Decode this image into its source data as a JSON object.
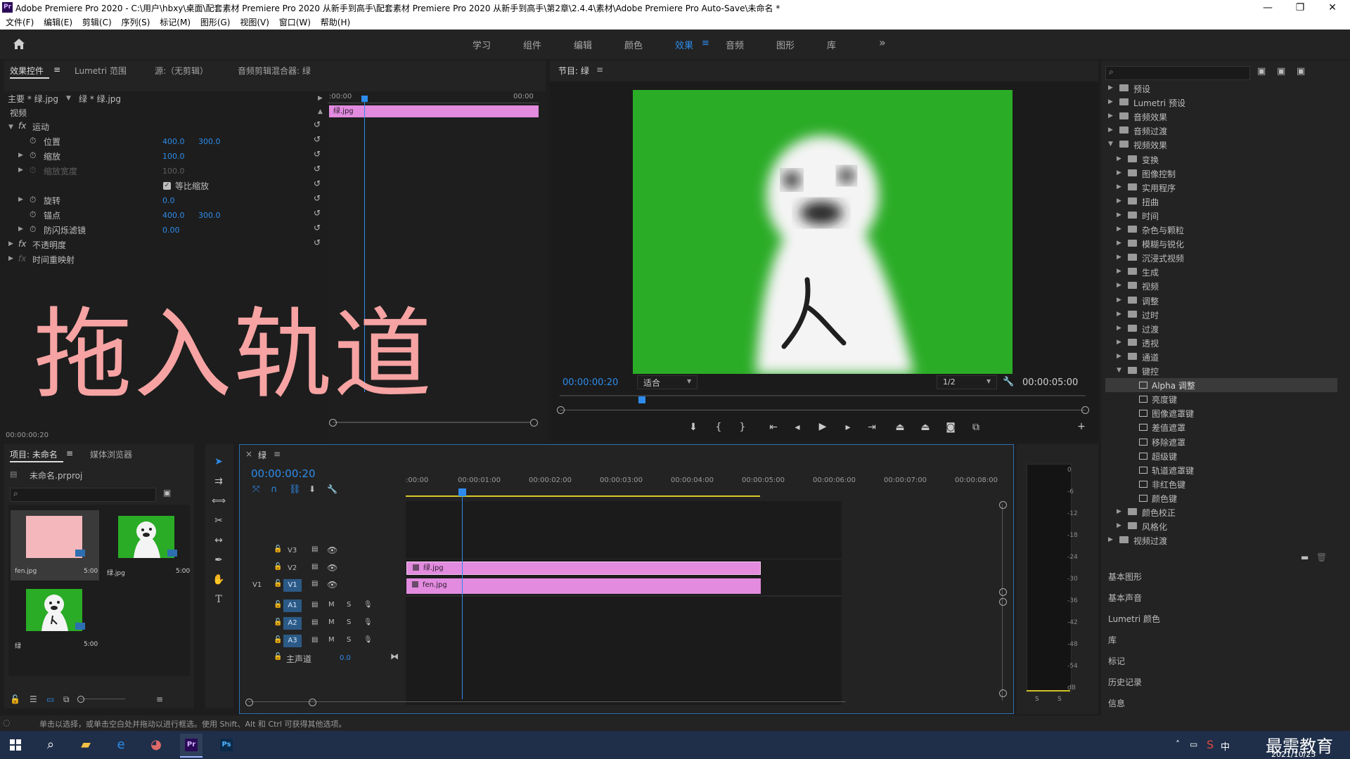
{
  "window": {
    "title": "Adobe Premiere Pro 2020 - C:\\用户\\hbxy\\桌面\\配套素材 Premiere Pro 2020 从新手到高手\\配套素材 Premiere Pro 2020 从新手到高手\\第2章\\2.4.4\\素材\\Adobe Premiere Pro Auto-Save\\未命名 *",
    "logo": "Pr",
    "minimize": "—",
    "maximize": "❐",
    "close": "✕"
  },
  "menubar": [
    "文件(F)",
    "编辑(E)",
    "剪辑(C)",
    "序列(S)",
    "标记(M)",
    "图形(G)",
    "视图(V)",
    "窗口(W)",
    "帮助(H)"
  ],
  "workspaces": {
    "items": [
      "学习",
      "组件",
      "编辑",
      "颜色",
      "效果",
      "音频",
      "图形",
      "库"
    ],
    "active": "效果",
    "more": "»",
    "menu": "≡"
  },
  "effect_controls": {
    "tabs": [
      "效果控件",
      "Lumetri 范围",
      "源:（无剪辑）",
      "音频剪辑混合器: 绿"
    ],
    "tab_menu": "≡",
    "master": "主要 * 绿.jpg",
    "sequence_clip": "绿 * 绿.jpg",
    "section": "视频",
    "fx": "fx",
    "motion": "运动",
    "position_label": "位置",
    "position_x": "400.0",
    "position_y": "300.0",
    "scale_label": "缩放",
    "scale_value": "100.0",
    "scale_width_label": "缩放宽度",
    "scale_width_value": "100.0",
    "uniform_label": "等比缩放",
    "rotation_label": "旋转",
    "rotation_value": "0.0",
    "anchor_label": "锚点",
    "anchor_x": "400.0",
    "anchor_y": "300.0",
    "flicker_label": "防闪烁滤镜",
    "flicker_value": "0.00",
    "opacity_label": "不透明度",
    "remap_label": "时间重映射",
    "time_start": ":00:00",
    "time_end": "00:00",
    "clip_name": "绿.jpg",
    "timecode": "00:00:00:20",
    "overlay_text": "拖入轨道"
  },
  "program_monitor": {
    "title": "节目: 绿",
    "menu": "≡",
    "timecode": "00:00:00:20",
    "fit": "适合",
    "resolution": "1/2",
    "duration": "00:00:05:00"
  },
  "effects_panel": {
    "search_placeholder": "",
    "tree": [
      {
        "label": "预设",
        "level": 0,
        "expanded": false
      },
      {
        "label": "Lumetri 预设",
        "level": 0,
        "expanded": false
      },
      {
        "label": "音频效果",
        "level": 0,
        "expanded": false
      },
      {
        "label": "音频过渡",
        "level": 0,
        "expanded": false
      },
      {
        "label": "视频效果",
        "level": 0,
        "expanded": true
      },
      {
        "label": "变换",
        "level": 1,
        "expanded": false
      },
      {
        "label": "图像控制",
        "level": 1,
        "expanded": false
      },
      {
        "label": "实用程序",
        "level": 1,
        "expanded": false
      },
      {
        "label": "扭曲",
        "level": 1,
        "expanded": false
      },
      {
        "label": "时间",
        "level": 1,
        "expanded": false
      },
      {
        "label": "杂色与颗粒",
        "level": 1,
        "expanded": false
      },
      {
        "label": "模糊与锐化",
        "level": 1,
        "expanded": false
      },
      {
        "label": "沉浸式视频",
        "level": 1,
        "expanded": false
      },
      {
        "label": "生成",
        "level": 1,
        "expanded": false
      },
      {
        "label": "视频",
        "level": 1,
        "expanded": false
      },
      {
        "label": "调整",
        "level": 1,
        "expanded": false
      },
      {
        "label": "过时",
        "level": 1,
        "expanded": false
      },
      {
        "label": "过渡",
        "level": 1,
        "expanded": false
      },
      {
        "label": "透视",
        "level": 1,
        "expanded": false
      },
      {
        "label": "通道",
        "level": 1,
        "expanded": false
      },
      {
        "label": "键控",
        "level": 1,
        "expanded": true
      },
      {
        "label": "Alpha 调整",
        "level": 2,
        "selected": true
      },
      {
        "label": "亮度键",
        "level": 2
      },
      {
        "label": "图像遮罩键",
        "level": 2
      },
      {
        "label": "差值遮罩",
        "level": 2
      },
      {
        "label": "移除遮罩",
        "level": 2
      },
      {
        "label": "超级键",
        "level": 2
      },
      {
        "label": "轨道遮罩键",
        "level": 2
      },
      {
        "label": "非红色键",
        "level": 2
      },
      {
        "label": "颜色键",
        "level": 2
      },
      {
        "label": "颜色校正",
        "level": 1,
        "expanded": false
      },
      {
        "label": "风格化",
        "level": 1,
        "expanded": false
      },
      {
        "label": "视频过渡",
        "level": 0,
        "expanded": false
      }
    ],
    "sections": [
      "基本图形",
      "基本声音",
      "Lumetri 颜色",
      "库",
      "标记",
      "历史记录",
      "信息"
    ]
  },
  "project": {
    "tabs": [
      "项目: 未命名",
      "媒体浏览器"
    ],
    "tab_menu": "≡",
    "file": "未命名.prproj",
    "items": [
      {
        "name": "fen.jpg",
        "duration": "5:00"
      },
      {
        "name": "绿.jpg",
        "duration": "5:00"
      },
      {
        "name": "绿",
        "duration": "5:00"
      }
    ]
  },
  "timeline": {
    "title": "绿",
    "menu": "≡",
    "close": "×",
    "timecode": "00:00:00:20",
    "ruler": [
      ":00:00",
      "00:00:01:00",
      "00:00:02:00",
      "00:00:03:00",
      "00:00:04:00",
      "00:00:05:00",
      "00:00:06:00",
      "00:00:07:00",
      "00:00:08:00"
    ],
    "tracks": [
      {
        "id": "V3",
        "kind": "video"
      },
      {
        "id": "V2",
        "kind": "video"
      },
      {
        "id": "V1",
        "kind": "video",
        "source": "V1"
      },
      {
        "id": "A1",
        "kind": "audio"
      },
      {
        "id": "A2",
        "kind": "audio"
      },
      {
        "id": "A3",
        "kind": "audio"
      }
    ],
    "mute": "M",
    "solo": "S",
    "master_label": "主声道",
    "master_value": "0.0",
    "clips": [
      {
        "track": "V2",
        "name": "绿.jpg"
      },
      {
        "track": "V1",
        "name": "fen.jpg"
      }
    ]
  },
  "audio_meter": {
    "ticks": [
      "0",
      "-6",
      "-12",
      "-18",
      "-24",
      "-30",
      "-36",
      "-42",
      "-48",
      "-54",
      "dB"
    ],
    "solo_left": "S",
    "solo_right": "S"
  },
  "status_bar": "单击以选择，或单击空白处并拖动以进行框选。使用 Shift、Alt 和 Ctrl 可获得其他选项。",
  "taskbar": {
    "watermark": "最需教育",
    "date": "2021/10/25",
    "ime": "中"
  },
  "colors": {
    "accent": "#2d8ceb",
    "clip": "#e28bdf",
    "overlay": "#f7a3a3",
    "monitor_bg": "#2aac26"
  }
}
